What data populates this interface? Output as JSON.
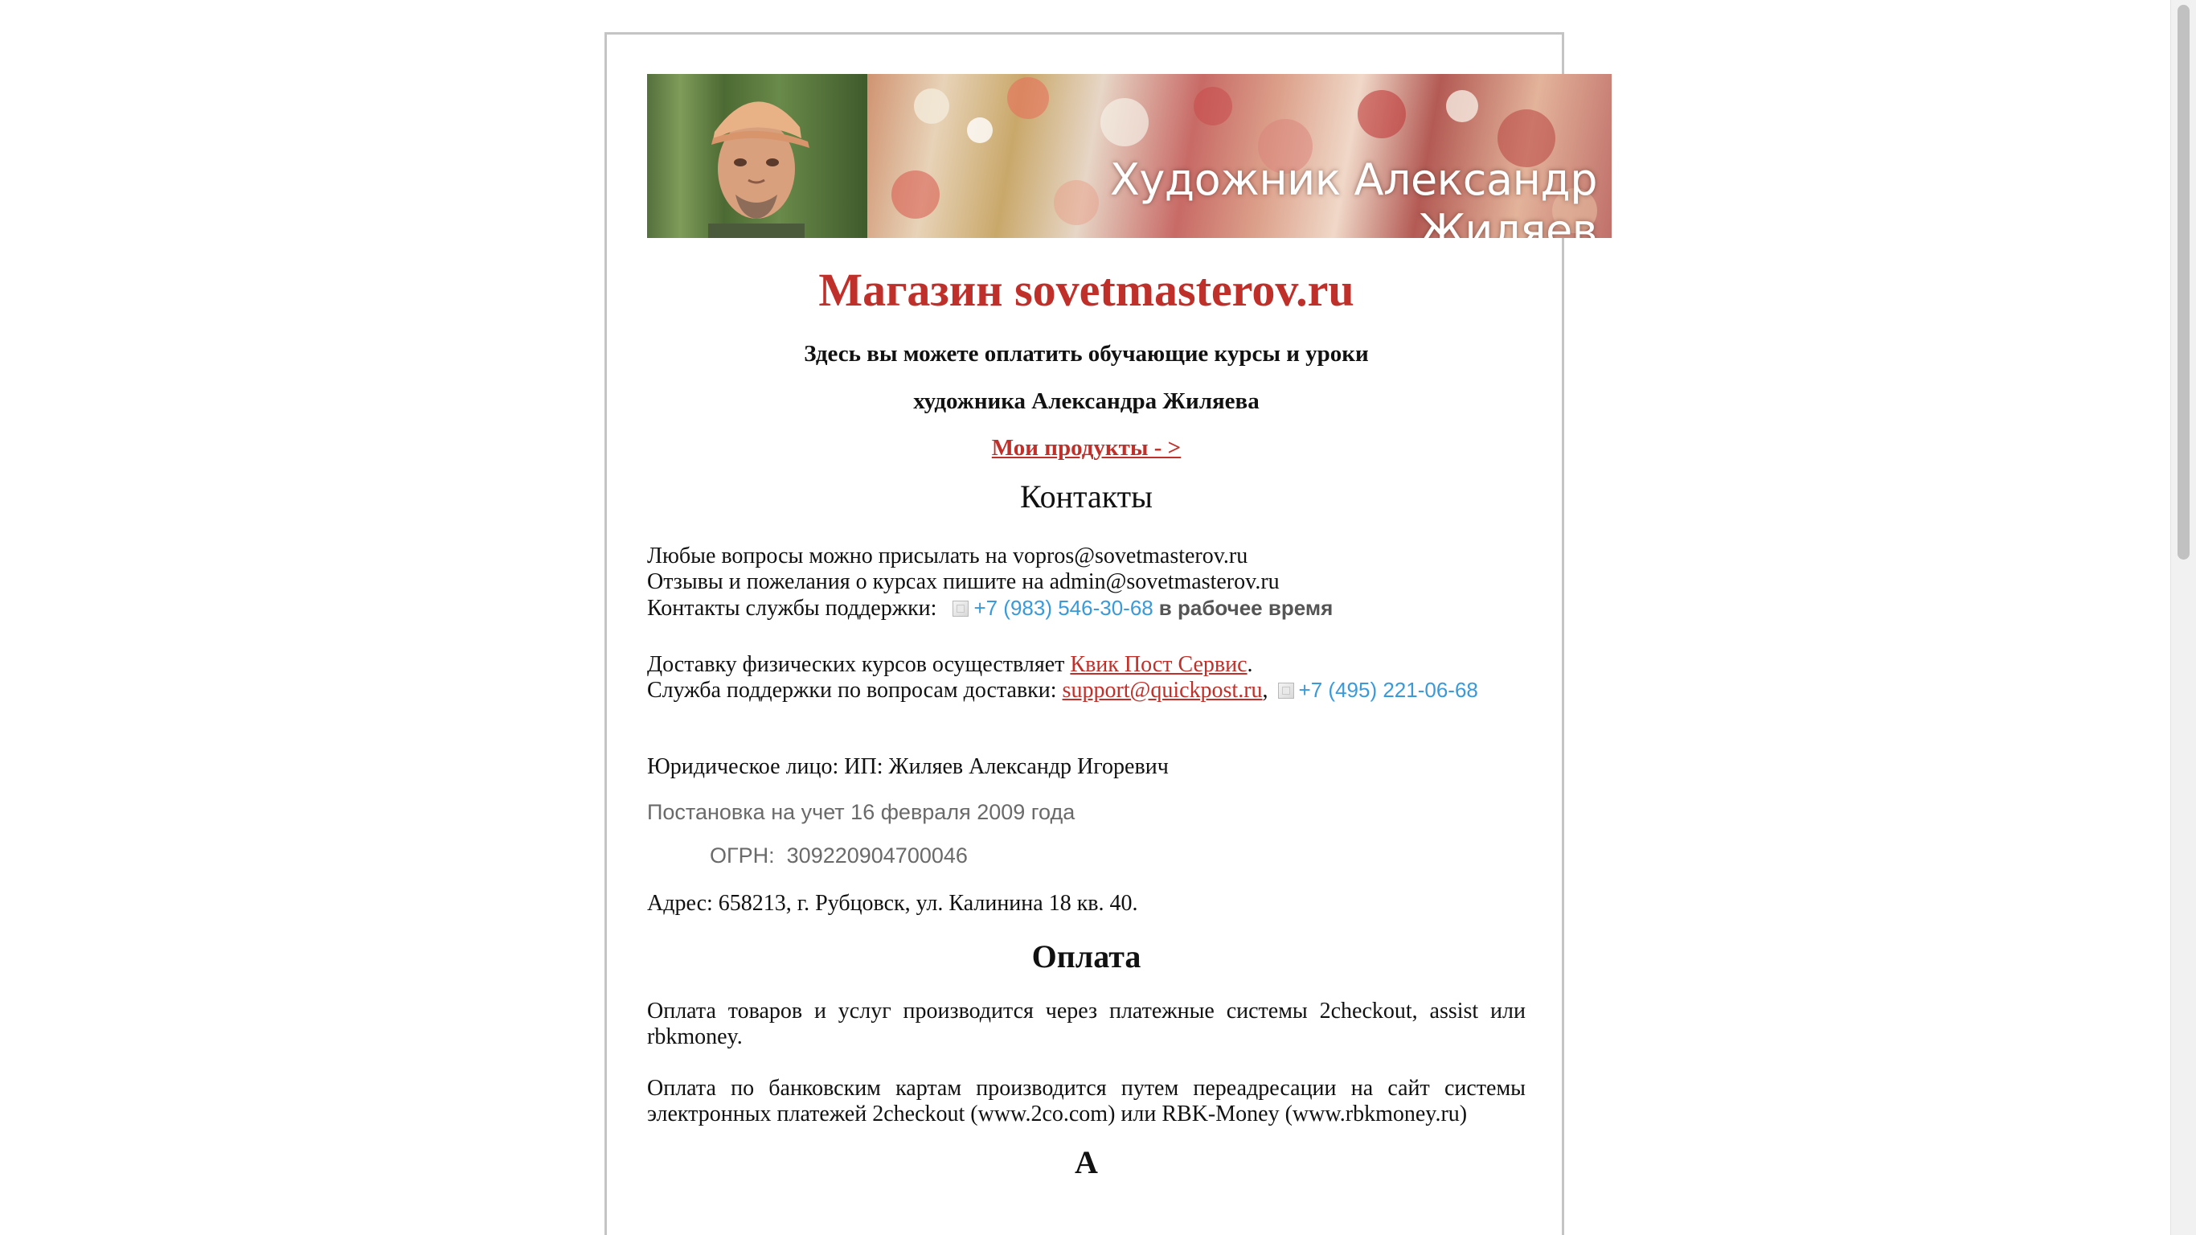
{
  "banner": {
    "title": "Художник Александр Жиляев"
  },
  "shop": {
    "title": "Магазин sovetmasterov.ru",
    "lead_line1": "Здесь вы можете оплатить обучающие курсы и уроки",
    "lead_line2": "художника Александра Жиляева",
    "products_link": "Мои продукты - >"
  },
  "contacts": {
    "heading": "Контакты",
    "questions": "Любые вопросы можно присылать на vopros@sovetmasterov.ru",
    "reviews": "Отзывы и пожелания о курсах пишите на admin@sovetmasterov.ru",
    "support_label": "Контакты службы поддержки:",
    "support_phone": "+7 (983) 546-30-68",
    "support_hours": "в рабочее время",
    "delivery_prefix": "Доставку физических курсов осуществляет",
    "delivery_company": "Квик Пост Сервис",
    "delivery_suffix": ".",
    "delivery_support_label": "Служба поддержки по вопросам доставки:",
    "delivery_support_email": "support@quickpost.ru",
    "delivery_support_comma": ",",
    "delivery_support_phone": "+7 (495) 221-06-68"
  },
  "legal": {
    "entity": "Юридическое лицо: ИП: Жиляев Александр Игоревич",
    "registration": "Постановка на учет 16 февраля 2009 года",
    "ogrn_label": "ОГРН:",
    "ogrn_value": "309220904700046",
    "address": "Адрес: 658213, г. Рубцовск, ул. Калинина 18 кв. 40."
  },
  "payment": {
    "heading": "Оплата",
    "para1": "Оплата товаров и услуг производится через платежные системы 2checkout, assist или rbkmoney.",
    "para2": "Оплата по банковским картам производится путем переадресации на сайт системы электронных платежей 2checkout (www.2co.com) или RBK-Money (www.rbkmoney.ru)"
  },
  "next_heading_partial": "А"
}
